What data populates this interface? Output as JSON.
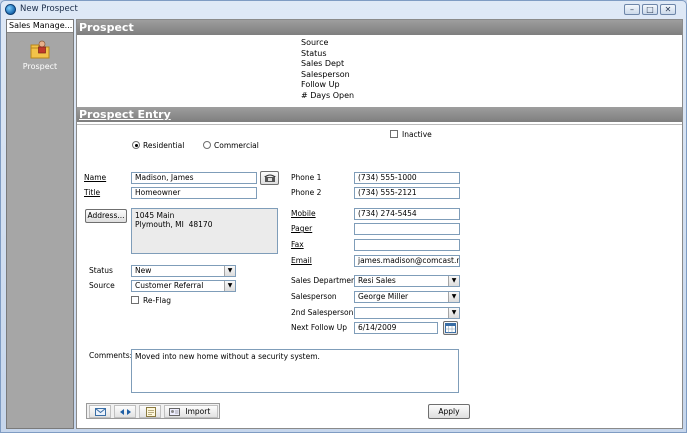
{
  "window": {
    "title": "New Prospect",
    "minimize": "–",
    "maximize": "□",
    "close": "✕"
  },
  "sidebar": {
    "header": "Sales Manage...",
    "item_label": "Prospect",
    "icon": "folder-person-icon"
  },
  "prospect": {
    "header": "Prospect",
    "summary": [
      "Source",
      "Status",
      "Sales Dept",
      "Salesperson",
      "Follow Up",
      "# Days Open"
    ]
  },
  "entry": {
    "header": "Prospect Entry",
    "type_residential": "Residential",
    "type_commercial": "Commercial",
    "inactive_label": "Inactive",
    "name_label": "Name",
    "name_value": "Madison, James",
    "title_label": "Title",
    "title_value": "Homeowner",
    "address_button": "Address...",
    "address_value": "1045 Main\nPlymouth, MI  48170",
    "status_label": "Status",
    "status_value": "New",
    "source_label": "Source",
    "source_value": "Customer Referral",
    "reflag_label": "Re-Flag",
    "phone1_label": "Phone 1",
    "phone1_value": "(734) 555-1000",
    "phone2_label": "Phone 2",
    "phone2_value": "(734) 555-2121",
    "mobile_label": "Mobile",
    "mobile_value": "(734) 274-5454",
    "pager_label": "Pager",
    "pager_value": "",
    "fax_label": "Fax",
    "fax_value": "",
    "email_label": "Email",
    "email_value": "james.madison@comcast.net",
    "sales_dept_label": "Sales Department",
    "sales_dept_value": "Resi Sales",
    "salesperson_label": "Salesperson",
    "salesperson_value": "George Miller",
    "second_salesperson_label": "2nd Salesperson",
    "second_salesperson_value": "",
    "next_follow_up_label": "Next Follow Up",
    "next_follow_up_value": "6/14/2009",
    "comments_label": "Comments:",
    "comments_value": "Moved into new home without a security system."
  },
  "toolbar": {
    "import_label": "Import",
    "apply_label": "Apply"
  }
}
